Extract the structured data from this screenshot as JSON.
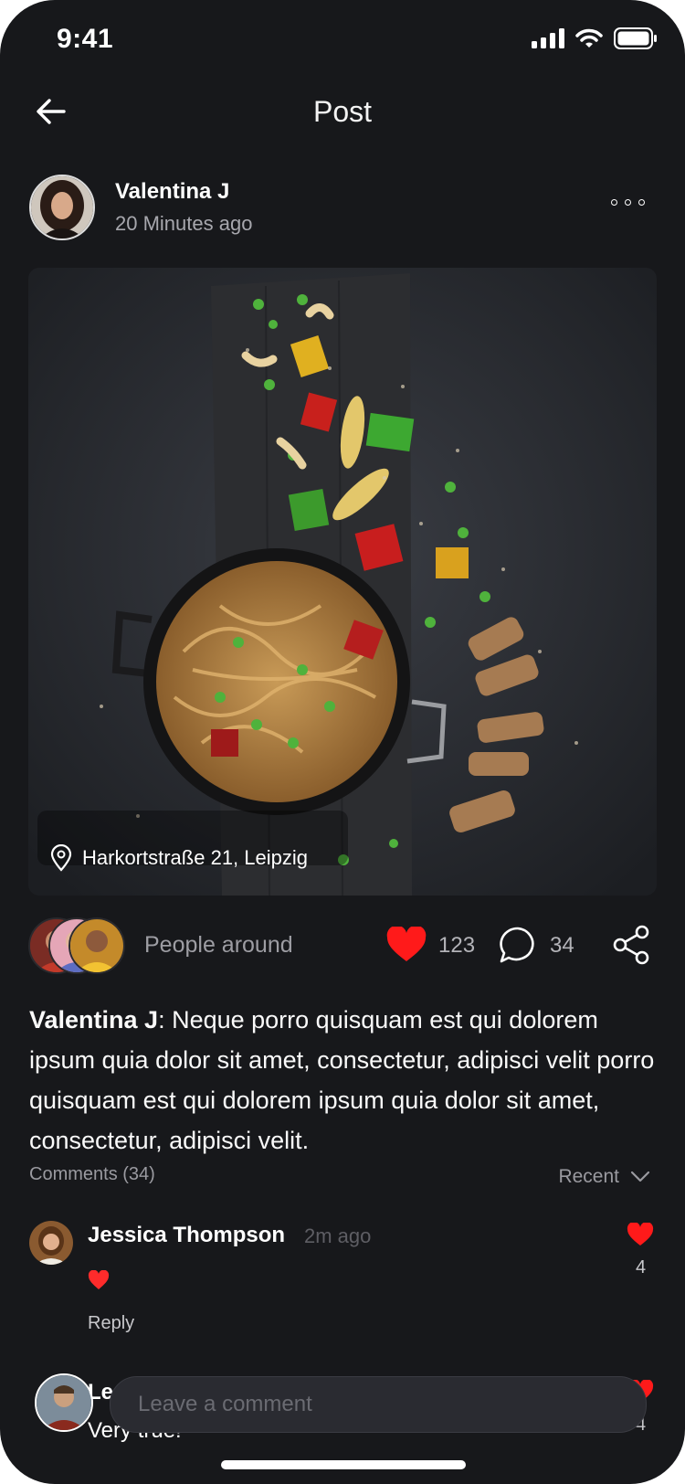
{
  "status_bar": {
    "time": "9:41"
  },
  "header": {
    "title": "Post",
    "back_icon": "arrow-left-icon"
  },
  "author": {
    "name": "Valentina J",
    "time": "20 Minutes ago",
    "more_icon": "more-horizontal-icon"
  },
  "post": {
    "location": "Harkortstraße 21, Leipzig",
    "people_label": "People around",
    "likes": "123",
    "comments": "34",
    "caption_author": "Valentina J",
    "caption_text": ": Neque porro quisquam est qui dolorem ipsum quia dolor sit amet, consectetur, adipisci velit porro quisquam est qui dolorem ipsum quia dolor sit amet, consectetur, adipisci velit."
  },
  "comments_section": {
    "title": "Comments (34)",
    "sort_label": "Recent",
    "items": [
      {
        "name": "Jessica Thompson",
        "time": "2m ago",
        "text": "❤️",
        "reply_label": "Reply",
        "likes": "4"
      },
      {
        "name": "Le",
        "text": "Very true!",
        "likes": "4"
      }
    ],
    "input_placeholder": "Leave a comment"
  },
  "colors": {
    "background": "#17181b",
    "like_red": "#ff1a1a",
    "text_muted": "#9d9da3"
  }
}
